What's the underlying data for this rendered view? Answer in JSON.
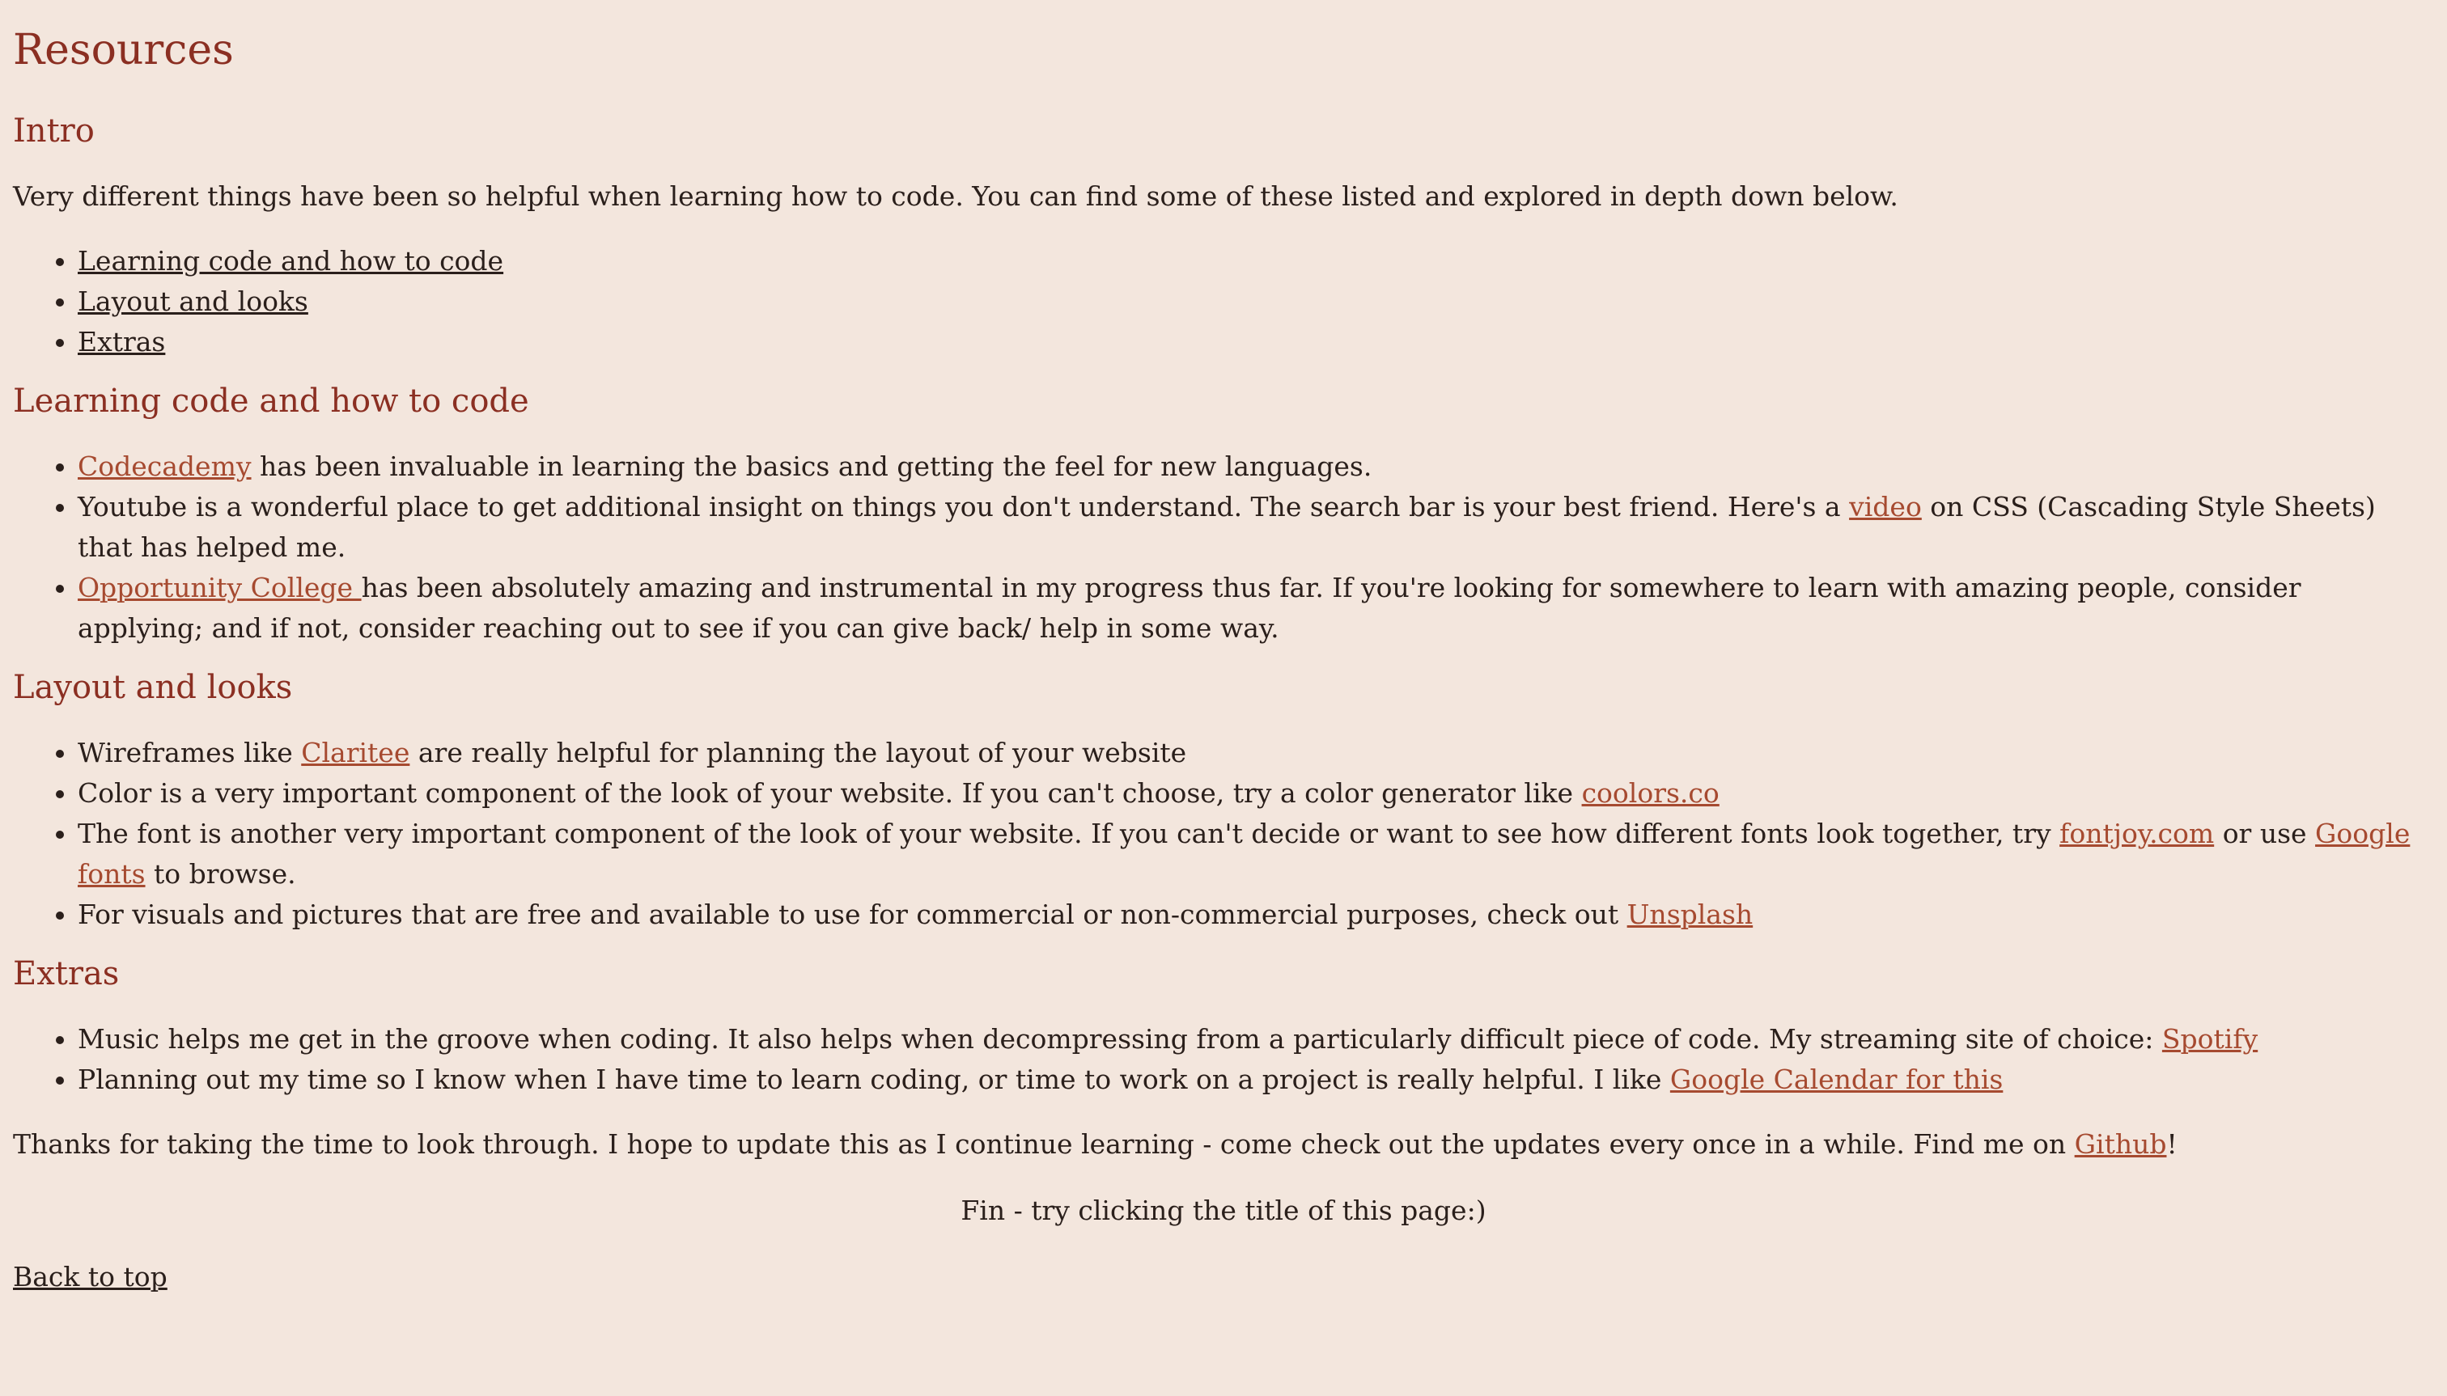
{
  "page": {
    "title": "Resources"
  },
  "intro": {
    "heading": "Intro",
    "text": "Very different things have been so helpful when learning how to code. You can find some of these listed and explored in depth down below.",
    "toc": [
      "Learning code and how to code",
      "Layout and looks",
      "Extras"
    ]
  },
  "learning": {
    "heading": "Learning code and how to code",
    "item1": {
      "link": "Codecademy",
      "text": " has been invaluable in learning the basics and getting the feel for new languages."
    },
    "item2": {
      "text_before": "Youtube is a wonderful place to get additional insight on things you don't understand. The search bar is your best friend. Here's a ",
      "link": "video",
      "text_after": " on CSS (Cascading Style Sheets) that has helped me."
    },
    "item3": {
      "link": "Opportunity College ",
      "text": "has been absolutely amazing and instrumental in my progress thus far. If you're looking for somewhere to learn with amazing people, consider applying; and if not, consider reaching out to see if you can give back/ help in some way."
    }
  },
  "layout": {
    "heading": "Layout and looks",
    "item1": {
      "text_before": "Wireframes like ",
      "link": "Claritee",
      "text_after": " are really helpful for planning the layout of your website"
    },
    "item2": {
      "text_before": "Color is a very important component of the look of your website. If you can't choose, try a color generator like ",
      "link": "coolors.co"
    },
    "item3": {
      "text_before": "The font is another very important component of the look of your website. If you can't decide or want to see how different fonts look together, try ",
      "link1": "fontjoy.com",
      "text_middle": " or use ",
      "link2": "Google fonts",
      "text_after": " to browse."
    },
    "item4": {
      "text_before": "For visuals and pictures that are free and available to use for commercial or non-commercial purposes, check out ",
      "link": "Unsplash"
    }
  },
  "extras": {
    "heading": "Extras",
    "item1": {
      "text_before": "Music helps me get in the groove when coding. It also helps when decompressing from a particularly difficult piece of code. My streaming site of choice: ",
      "link": "Spotify"
    },
    "item2": {
      "text_before": "Planning out my time so I know when I have time to learn coding, or time to work on a project is really helpful. I like ",
      "link": "Google Calendar for this"
    }
  },
  "outro": {
    "text_before": "Thanks for taking the time to look through. I hope to update this as I continue learning - come check out the updates every once in a while. Find me on ",
    "link": "Github",
    "text_after": "!"
  },
  "fin": "Fin - try clicking the title of this page:)",
  "back_to_top": "Back to top",
  "colors": {
    "background": "#f3e6dd",
    "heading": "#8b2f22",
    "link": "#a64a30",
    "text": "#2a1f1b"
  }
}
